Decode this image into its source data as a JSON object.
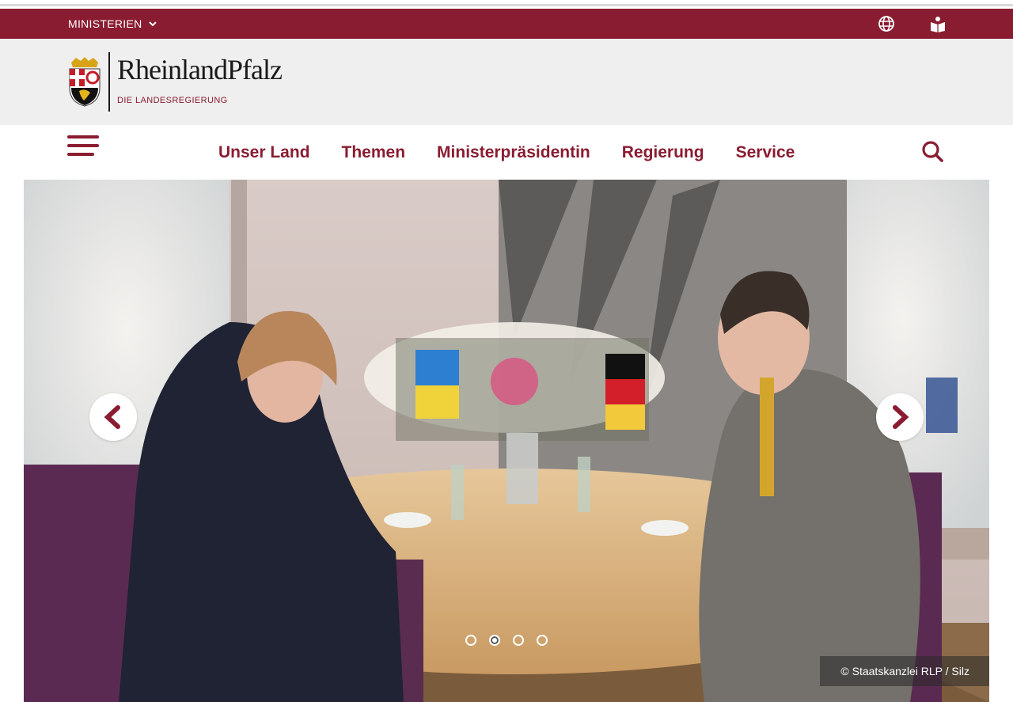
{
  "ministry_bar": {
    "label": "MINISTERIEN",
    "color": "#8a1c31"
  },
  "icons": {
    "language": "globe-icon",
    "easy_language": "reading-book-icon",
    "search": "search-icon",
    "menu": "hamburger-menu-icon"
  },
  "logo": {
    "wordmark": "RheinlandPfalz",
    "subline": "DIE LANDESREGIERUNG"
  },
  "nav": {
    "items": [
      "Unser Land",
      "Themen",
      "Ministerpräsidentin",
      "Regierung",
      "Service"
    ]
  },
  "hero": {
    "slides": 4,
    "active_slide": 2,
    "credit": "© Staatskanzlei RLP / Silz"
  },
  "colors": {
    "brand": "#8a1c31",
    "header_bg": "#efefef"
  }
}
